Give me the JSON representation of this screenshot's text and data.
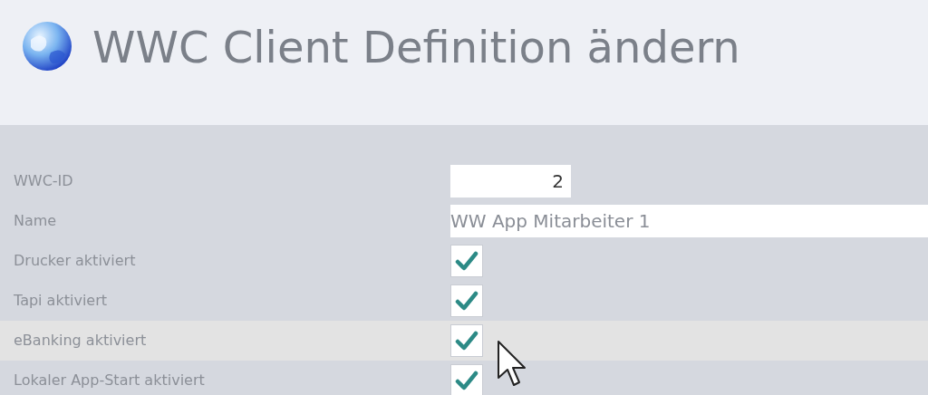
{
  "title": "WWC Client Definition ändern",
  "fields": [
    {
      "label": "WWC-ID",
      "kind": "number",
      "value": "2",
      "highlighted": false
    },
    {
      "label": "Name",
      "kind": "text",
      "value": "WW App Mitarbeiter 1",
      "highlighted": false
    },
    {
      "label": "Drucker aktiviert",
      "kind": "checkbox",
      "checked": true,
      "highlighted": false
    },
    {
      "label": "Tapi aktiviert",
      "kind": "checkbox",
      "checked": true,
      "highlighted": false
    },
    {
      "label": "eBanking aktiviert",
      "kind": "checkbox",
      "checked": true,
      "highlighted": true
    },
    {
      "label": "Lokaler App-Start aktiviert",
      "kind": "checkbox",
      "checked": true,
      "highlighted": false
    }
  ]
}
